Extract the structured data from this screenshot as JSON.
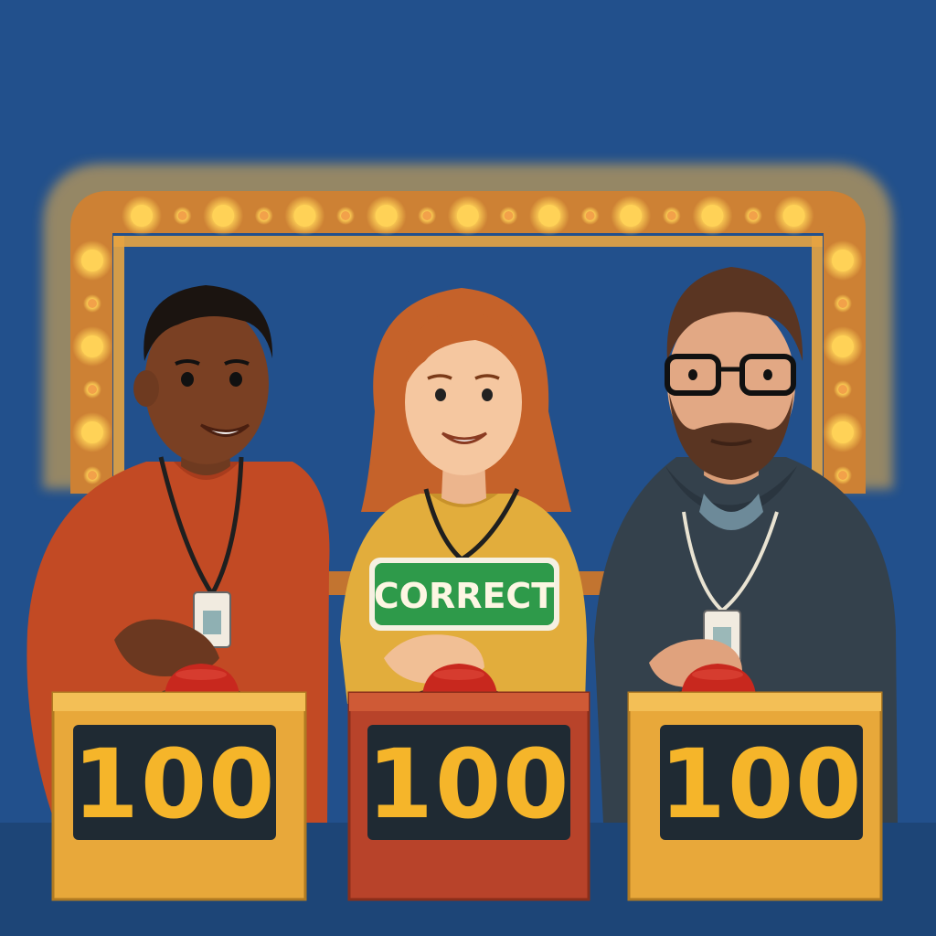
{
  "scene": {
    "contestants": [
      {
        "name": "contestant-left",
        "score": "100",
        "podium_color": "#e8a83a"
      },
      {
        "name": "contestant-middle",
        "score": "100",
        "podium_color": "#b8432a",
        "sign": "CORRECT"
      },
      {
        "name": "contestant-right",
        "score": "100",
        "podium_color": "#e8a83a"
      }
    ],
    "colors": {
      "background": "#22508c",
      "marquee_frame": "#d9892f",
      "bulb": "#ffd257",
      "score_digits": "#f5b52a",
      "score_panel": "#1f2a33",
      "buzzer": "#c8281e",
      "correct_sign": "#2e9a4a"
    }
  }
}
